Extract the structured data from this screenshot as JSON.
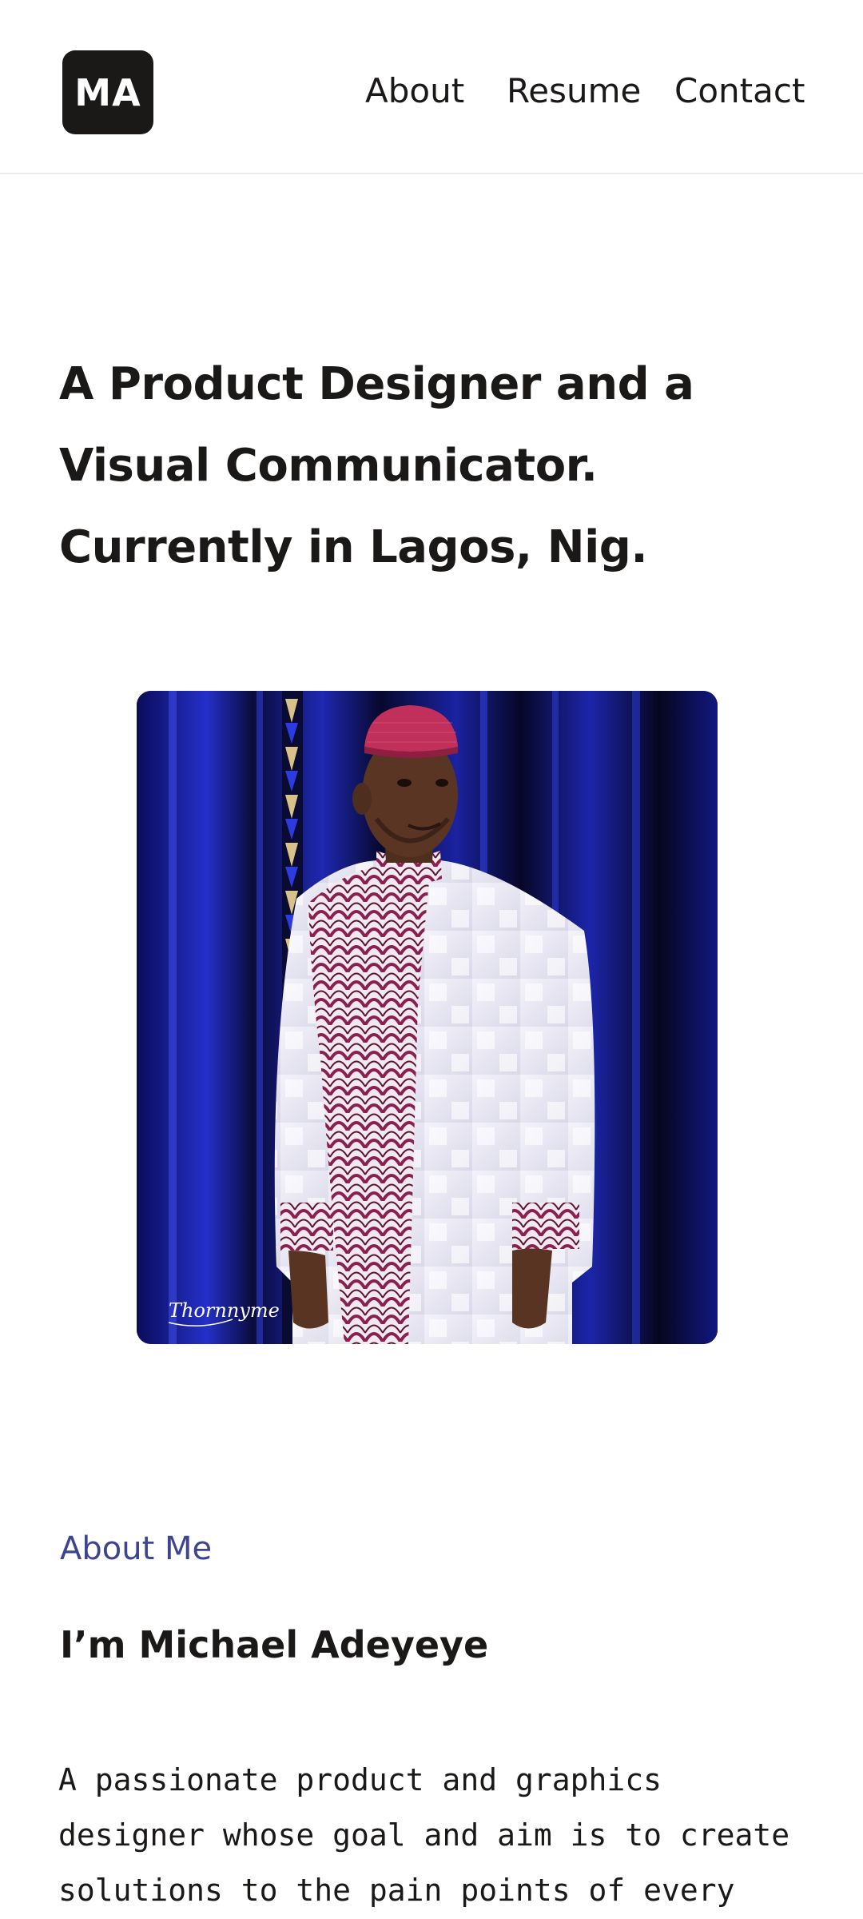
{
  "header": {
    "logo_text": "MA",
    "nav": [
      {
        "label": "About"
      },
      {
        "label": "Resume"
      },
      {
        "label": "Contact"
      }
    ]
  },
  "hero": {
    "lines": [
      "A Product Designer and a",
      "Visual Communicator.",
      "Currently in Lagos, Nig."
    ]
  },
  "portrait": {
    "signature_text": "Thornnyme"
  },
  "about": {
    "label": "About Me",
    "heading": "I’m Michael Adeyeye",
    "bio_lines": [
      "A passionate product and graphics",
      "designer whose goal and aim is to create",
      "solutions to the pain points of every"
    ]
  },
  "colors": {
    "text": "#1b1918",
    "accent": "#3d4590",
    "logo_bg": "#1b1918",
    "divider": "#ececec"
  }
}
